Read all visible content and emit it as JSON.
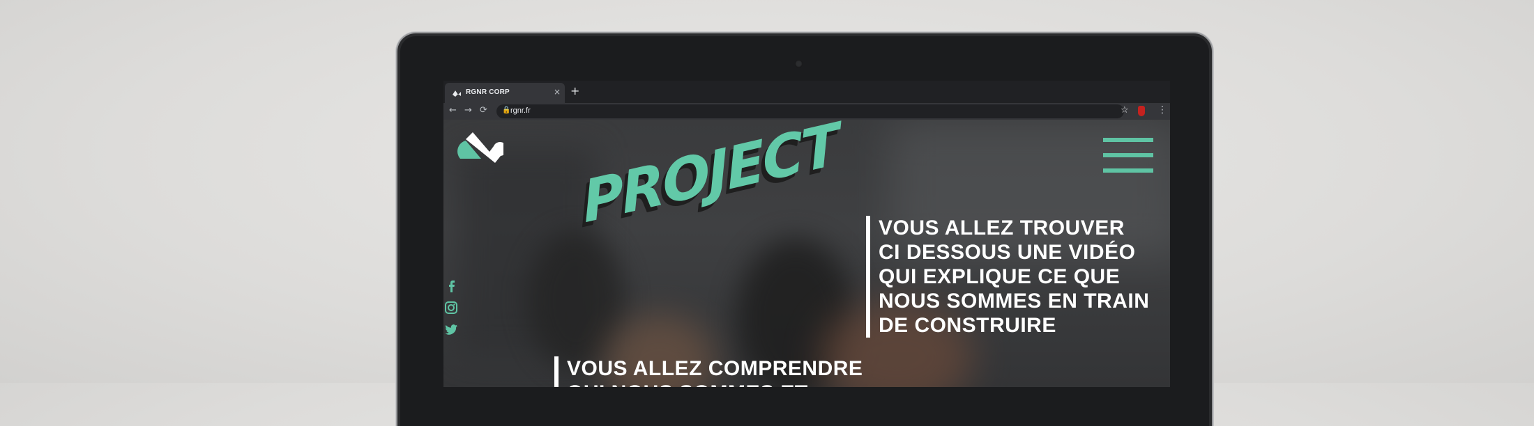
{
  "browser": {
    "tab_title": "RGNR CORP",
    "tab_close": "×",
    "new_tab": "+",
    "back": "←",
    "forward": "→",
    "reload": "⟳",
    "lock": "🔒",
    "url": "rgnr.fr",
    "star": "☆",
    "menu": "⋮"
  },
  "page": {
    "heading": "PROJECT",
    "intro_lines": [
      "VOUS ALLEZ TROUVER",
      "CI DESSOUS UNE VIDÉO",
      "QUI EXPLIQUE CE QUE",
      "NOUS SOMMES EN TRAIN",
      "DE CONSTRUIRE"
    ],
    "second_lines": [
      "VOUS ALLEZ COMPRENDRE",
      "QUI NOUS SOMMES ET"
    ],
    "accent_color": "#5fc4a4",
    "social_icons": [
      "facebook-icon",
      "instagram-icon",
      "twitter-icon"
    ]
  }
}
